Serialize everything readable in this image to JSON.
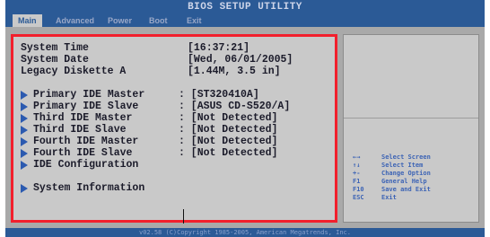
{
  "header": {
    "title": "BIOS SETUP UTILITY",
    "tabs": [
      "Main",
      "Advanced",
      "Power",
      "Boot",
      "Exit"
    ],
    "active_tab": "Main"
  },
  "main": {
    "system_time": {
      "label": "System Time",
      "value": "[16:37:21]"
    },
    "system_date": {
      "label": "System Date",
      "value": "[Wed, 06/01/2005]"
    },
    "legacy_diskette": {
      "label": "Legacy Diskette A",
      "value": "[1.44M, 3.5 in]"
    },
    "devices": [
      {
        "label": "Primary IDE Master",
        "value": ": [ST320410A]"
      },
      {
        "label": "Primary IDE Slave",
        "value": ": [ASUS CD-S520/A]"
      },
      {
        "label": "Third IDE Master",
        "value": ": [Not Detected]"
      },
      {
        "label": "Third IDE Slave",
        "value": ": [Not Detected]"
      },
      {
        "label": "Fourth IDE Master",
        "value": ": [Not Detected]"
      },
      {
        "label": "Fourth IDE Slave",
        "value": ": [Not Detected]"
      }
    ],
    "ide_configuration": "IDE Configuration",
    "system_information": "System Information"
  },
  "help": {
    "keys": [
      {
        "key": "←→",
        "desc": "Select Screen"
      },
      {
        "key": "↑↓",
        "desc": "Select Item"
      },
      {
        "key": "+-",
        "desc": "Change Option"
      },
      {
        "key": "F1",
        "desc": "General Help"
      },
      {
        "key": "F10",
        "desc": "Save and Exit"
      },
      {
        "key": "ESC",
        "desc": "Exit"
      }
    ]
  },
  "footer": {
    "text": "v02.58 (C)Copyright 1985-2005, American Megatrends, Inc."
  },
  "colors": {
    "menubar": "#2b5a96",
    "panel": "#c9c9c9",
    "highlight_border": "#f21f2c",
    "help_text": "#3d64b5"
  }
}
